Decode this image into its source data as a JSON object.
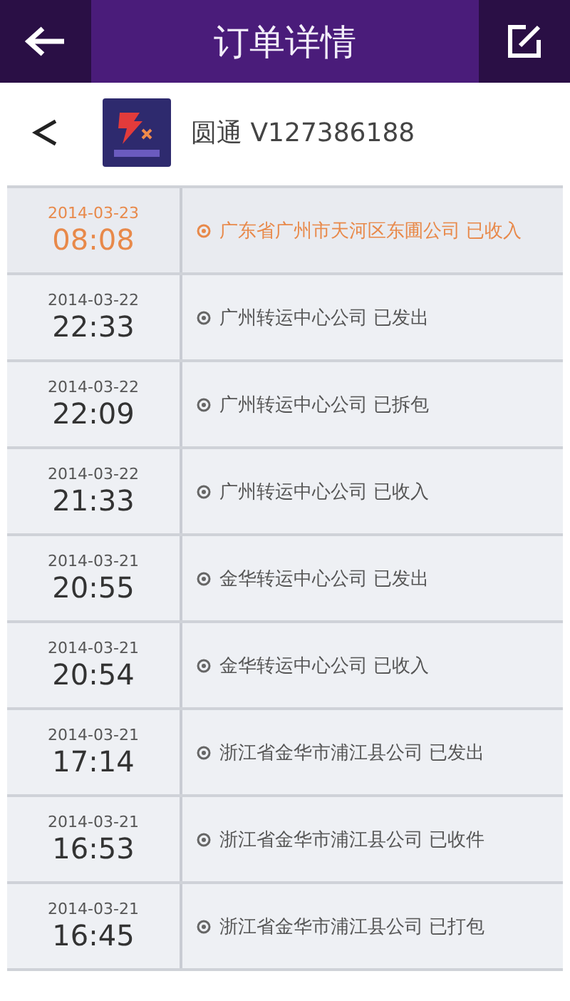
{
  "header": {
    "title": "订单详情"
  },
  "company": {
    "name": "圆通 V127386188"
  },
  "events": [
    {
      "date": "2014-03-23",
      "time": "08:08",
      "text": "广东省广州市天河区东圃公司 已收入",
      "latest": true
    },
    {
      "date": "2014-03-22",
      "time": "22:33",
      "text": "广州转运中心公司 已发出",
      "latest": false
    },
    {
      "date": "2014-03-22",
      "time": "22:09",
      "text": "广州转运中心公司 已拆包",
      "latest": false
    },
    {
      "date": "2014-03-22",
      "time": "21:33",
      "text": "广州转运中心公司 已收入",
      "latest": false
    },
    {
      "date": "2014-03-21",
      "time": "20:55",
      "text": "金华转运中心公司 已发出",
      "latest": false
    },
    {
      "date": "2014-03-21",
      "time": "20:54",
      "text": "金华转运中心公司 已收入",
      "latest": false
    },
    {
      "date": "2014-03-21",
      "time": "17:14",
      "text": "浙江省金华市浦江县公司 已发出",
      "latest": false
    },
    {
      "date": "2014-03-21",
      "time": "16:53",
      "text": "浙江省金华市浦江县公司 已收件",
      "latest": false
    },
    {
      "date": "2014-03-21",
      "time": "16:45",
      "text": "浙江省金华市浦江县公司 已打包",
      "latest": false
    }
  ]
}
